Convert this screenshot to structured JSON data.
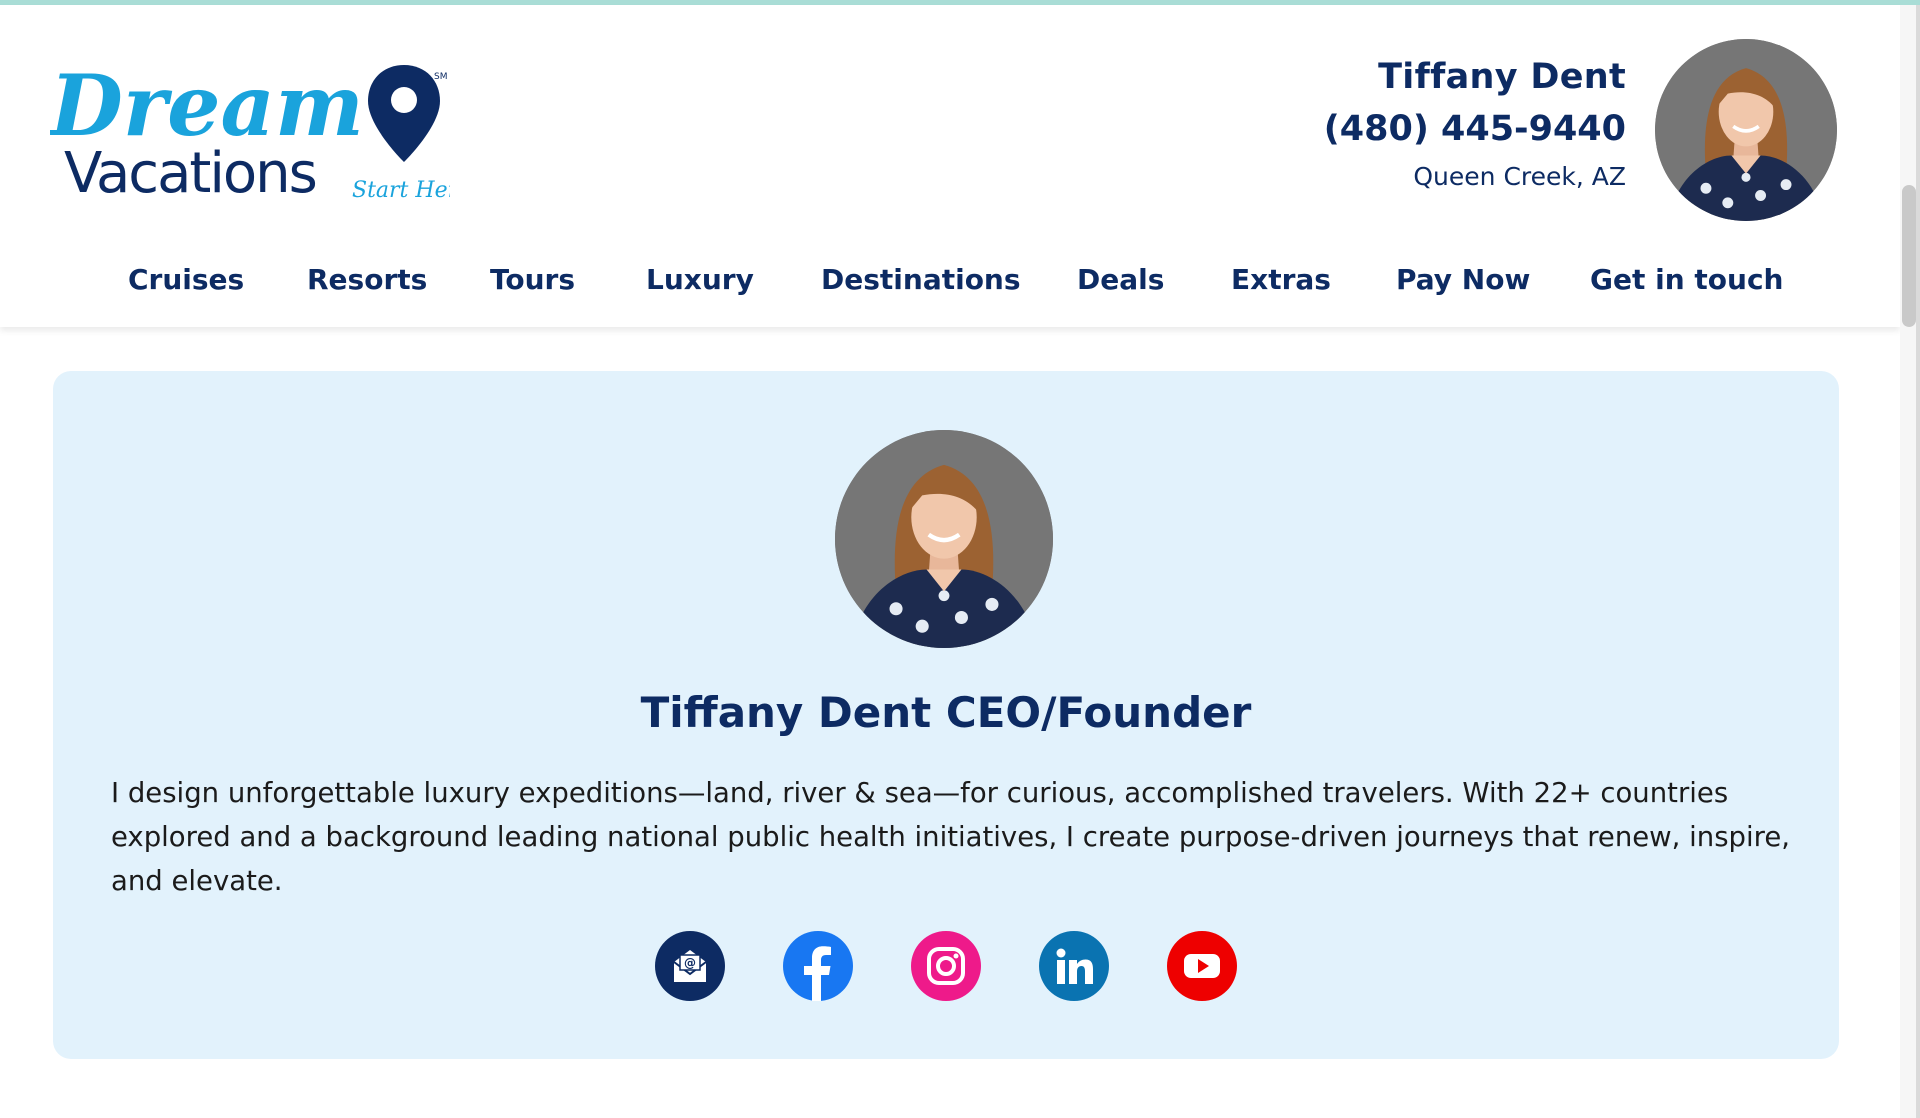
{
  "brand": {
    "logo_word_1": "Dream",
    "logo_word_2": "Vacations",
    "logo_tagline": "Start Here",
    "logo_mark": "SM",
    "primary_color": "#0d2b63",
    "accent_color": "#1aa3dc"
  },
  "agent": {
    "name": "Tiffany Dent",
    "phone": "(480) 445-9440",
    "location": "Queen Creek, AZ"
  },
  "nav": {
    "items": [
      {
        "label": "Cruises"
      },
      {
        "label": "Resorts"
      },
      {
        "label": "Tours"
      },
      {
        "label": "Luxury"
      },
      {
        "label": "Destinations"
      },
      {
        "label": "Deals"
      },
      {
        "label": "Extras"
      },
      {
        "label": "Pay Now"
      },
      {
        "label": "Get in touch"
      }
    ]
  },
  "profile": {
    "title": "Tiffany Dent CEO/Founder",
    "bio": "I design unforgettable luxury expeditions—land, river & sea—for curious, accomplished travelers. With 22+ countries explored and a background leading national public health initiatives, I create purpose-driven journeys that renew, inspire, and elevate.",
    "card_background": "#e2f2fc"
  },
  "socials": [
    {
      "icon": "email-icon",
      "color": "#0d2b63"
    },
    {
      "icon": "facebook-icon",
      "color": "#1877f2"
    },
    {
      "icon": "instagram-icon",
      "color": "#ee1a8a"
    },
    {
      "icon": "linkedin-icon",
      "color": "#0a73b1"
    },
    {
      "icon": "youtube-icon",
      "color": "#ee0000"
    }
  ]
}
